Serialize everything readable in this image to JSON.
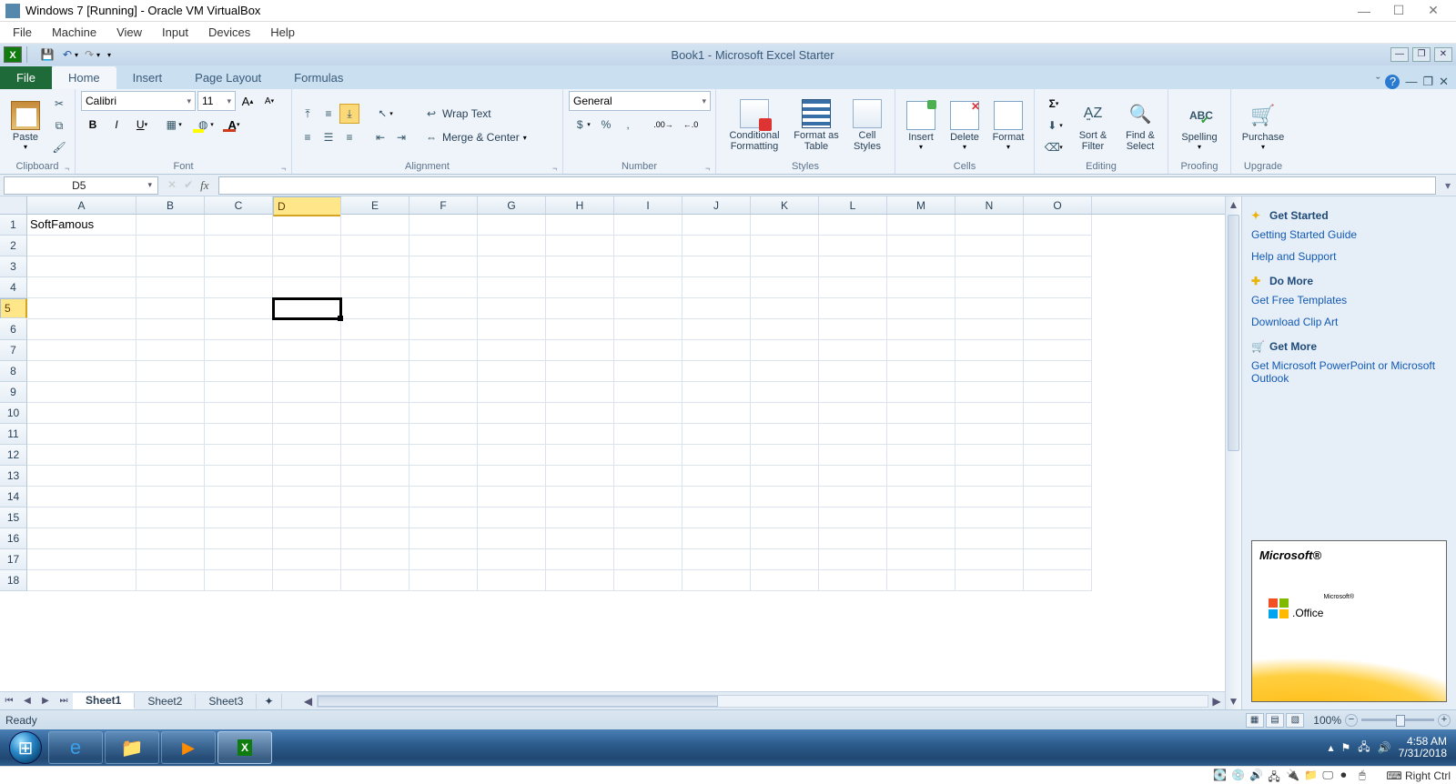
{
  "vbox": {
    "title": "Windows 7 [Running] - Oracle VM VirtualBox",
    "menus": [
      "File",
      "Machine",
      "View",
      "Input",
      "Devices",
      "Help"
    ],
    "status_text": "Right Ctrl"
  },
  "excel": {
    "title": "Book1  -  Microsoft Excel Starter",
    "tabs": {
      "file": "File",
      "home": "Home",
      "insert": "Insert",
      "pagelayout": "Page Layout",
      "formulas": "Formulas"
    },
    "groups": {
      "clipboard": "Clipboard",
      "font": "Font",
      "alignment": "Alignment",
      "number": "Number",
      "styles": "Styles",
      "cells": "Cells",
      "editing": "Editing",
      "proofing": "Proofing",
      "upgrade": "Upgrade"
    },
    "buttons": {
      "paste": "Paste",
      "wrap_text": "Wrap Text",
      "merge_center": "Merge & Center",
      "conditional_formatting": "Conditional Formatting",
      "format_as_table": "Format as Table",
      "cell_styles": "Cell Styles",
      "insert_cells": "Insert",
      "delete_cells": "Delete",
      "format_cells": "Format",
      "sort_filter": "Sort & Filter",
      "find_select": "Find & Select",
      "spelling": "Spelling",
      "purchase": "Purchase"
    },
    "font": {
      "name": "Calibri",
      "size": "11"
    },
    "number_format": "General",
    "name_box": "D5",
    "formula": "",
    "a1_value": "SoftFamous",
    "columns": [
      "A",
      "B",
      "C",
      "D",
      "E",
      "F",
      "G",
      "H",
      "I",
      "J",
      "K",
      "L",
      "M",
      "N",
      "O"
    ],
    "rows": [
      "1",
      "2",
      "3",
      "4",
      "5",
      "6",
      "7",
      "8",
      "9",
      "10",
      "11",
      "12",
      "13",
      "14",
      "15",
      "16",
      "17",
      "18"
    ],
    "selected_col": "D",
    "selected_row": "5",
    "sheets": [
      "Sheet1",
      "Sheet2",
      "Sheet3"
    ],
    "status": "Ready",
    "zoom": "100%"
  },
  "taskpane": {
    "h1": "Get Started",
    "links1": [
      "Getting Started Guide",
      "Help and Support"
    ],
    "h2": "Do More",
    "links2": [
      "Get Free Templates",
      "Download Clip Art"
    ],
    "h3": "Get More",
    "links3": [
      "Get Microsoft PowerPoint or Microsoft Outlook"
    ],
    "ad_ms": "Microsoft®",
    "ad_office": "Office"
  },
  "windows": {
    "time": "4:58 AM",
    "date": "7/31/2018"
  }
}
